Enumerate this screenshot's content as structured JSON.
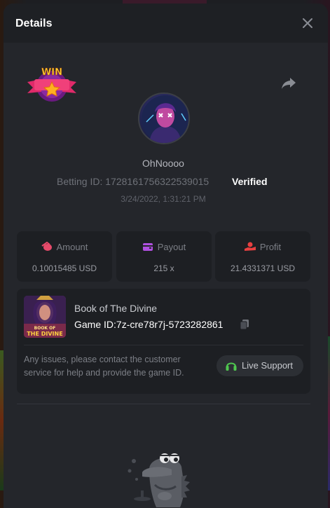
{
  "modal": {
    "title": "Details"
  },
  "bet": {
    "username": "OhNoooo",
    "betting_id_label": "Betting ID:",
    "betting_id": "1728161756322539015",
    "verified": "Verified",
    "timestamp": "3/24/2022, 1:31:21 PM",
    "badge_text": "WIN"
  },
  "stats": [
    {
      "label": "Amount",
      "value": "0.10015485 USD",
      "icon": "coins-icon",
      "color": "#e64a6a"
    },
    {
      "label": "Payout",
      "value": "215 x",
      "icon": "wallet-icon",
      "color": "#b050e0"
    },
    {
      "label": "Profit",
      "value": "21.4331371 USD",
      "icon": "hand-coin-icon",
      "color": "#e84040"
    }
  ],
  "game": {
    "name": "Book of The Divine",
    "id_label": "Game ID:",
    "id": "7z-cre78r7j-5723282861",
    "thumb_text_1": "BOOK OF",
    "thumb_text_2": "THE DIVINE"
  },
  "support": {
    "issue_text": "Any issues, please contact the customer service for help and provide the game ID.",
    "button_label": "Live Support",
    "accent": "#4fc84f"
  }
}
